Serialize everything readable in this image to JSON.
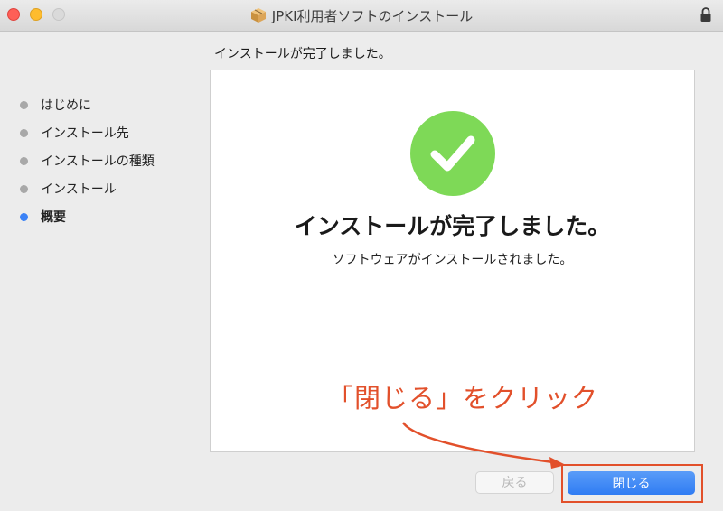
{
  "window": {
    "title": "JPKI利用者ソフトのインストール"
  },
  "header": {
    "text": "インストールが完了しました。"
  },
  "sidebar": {
    "items": [
      {
        "label": "はじめに",
        "active": false
      },
      {
        "label": "インストール先",
        "active": false
      },
      {
        "label": "インストールの種類",
        "active": false
      },
      {
        "label": "インストール",
        "active": false
      },
      {
        "label": "概要",
        "active": true
      }
    ]
  },
  "panel": {
    "heading": "インストールが完了しました。",
    "subtext": "ソフトウェアがインストールされました。",
    "icon": "checkmark-circle-icon"
  },
  "annotation": {
    "text": "「閉じる」をクリック"
  },
  "buttons": {
    "back_label": "戻る",
    "close_label": "閉じる"
  },
  "colors": {
    "accent_blue": "#3b82f6",
    "success_green": "#7ed957",
    "annotation_red": "#e2502b"
  }
}
